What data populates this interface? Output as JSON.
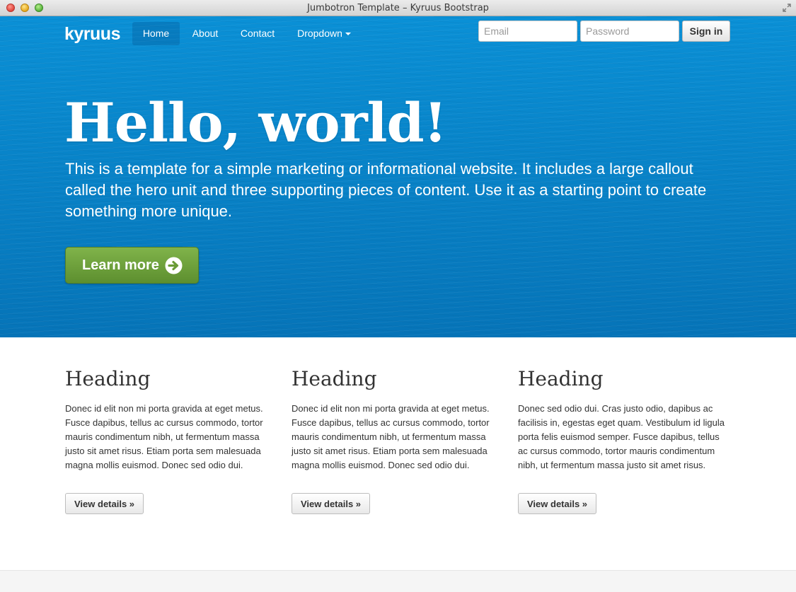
{
  "window": {
    "title": "Jumbotron Template – Kyruus Bootstrap"
  },
  "navbar": {
    "brand": "kyruus",
    "items": [
      {
        "label": "Home",
        "active": true
      },
      {
        "label": "About"
      },
      {
        "label": "Contact"
      },
      {
        "label": "Dropdown"
      }
    ],
    "email_placeholder": "Email",
    "password_placeholder": "Password",
    "signin_label": "Sign in"
  },
  "hero": {
    "title": "Hello, world!",
    "text": "This is a template for a simple marketing or informational website. It includes a large callout called the hero unit and three supporting pieces of content. Use it as a starting point to create something more unique.",
    "button_label": "Learn more",
    "button_icon": "arrow-circle-right-icon"
  },
  "columns": [
    {
      "heading": "Heading",
      "body": "Donec id elit non mi porta gravida at eget metus. Fusce dapibus, tellus ac cursus commodo, tortor mauris condimentum nibh, ut fermentum massa justo sit amet risus. Etiam porta sem malesuada magna mollis euismod. Donec sed odio dui.",
      "button_label": "View details »"
    },
    {
      "heading": "Heading",
      "body": "Donec id elit non mi porta gravida at eget metus. Fusce dapibus, tellus ac cursus commodo, tortor mauris condimentum nibh, ut fermentum massa justo sit amet risus. Etiam porta sem malesuada magna mollis euismod. Donec sed odio dui.",
      "button_label": "View details »"
    },
    {
      "heading": "Heading",
      "body": "Donec sed odio dui. Cras justo odio, dapibus ac facilisis in, egestas eget quam. Vestibulum id ligula porta felis euismod semper. Fusce dapibus, tellus ac cursus commodo, tortor mauris condimentum nibh, ut fermentum massa justo sit amet risus.",
      "button_label": "View details »"
    }
  ],
  "colors": {
    "hero_blue": "#0a86cc",
    "cta_green": "#6fa23d",
    "text_dark": "#333333"
  }
}
